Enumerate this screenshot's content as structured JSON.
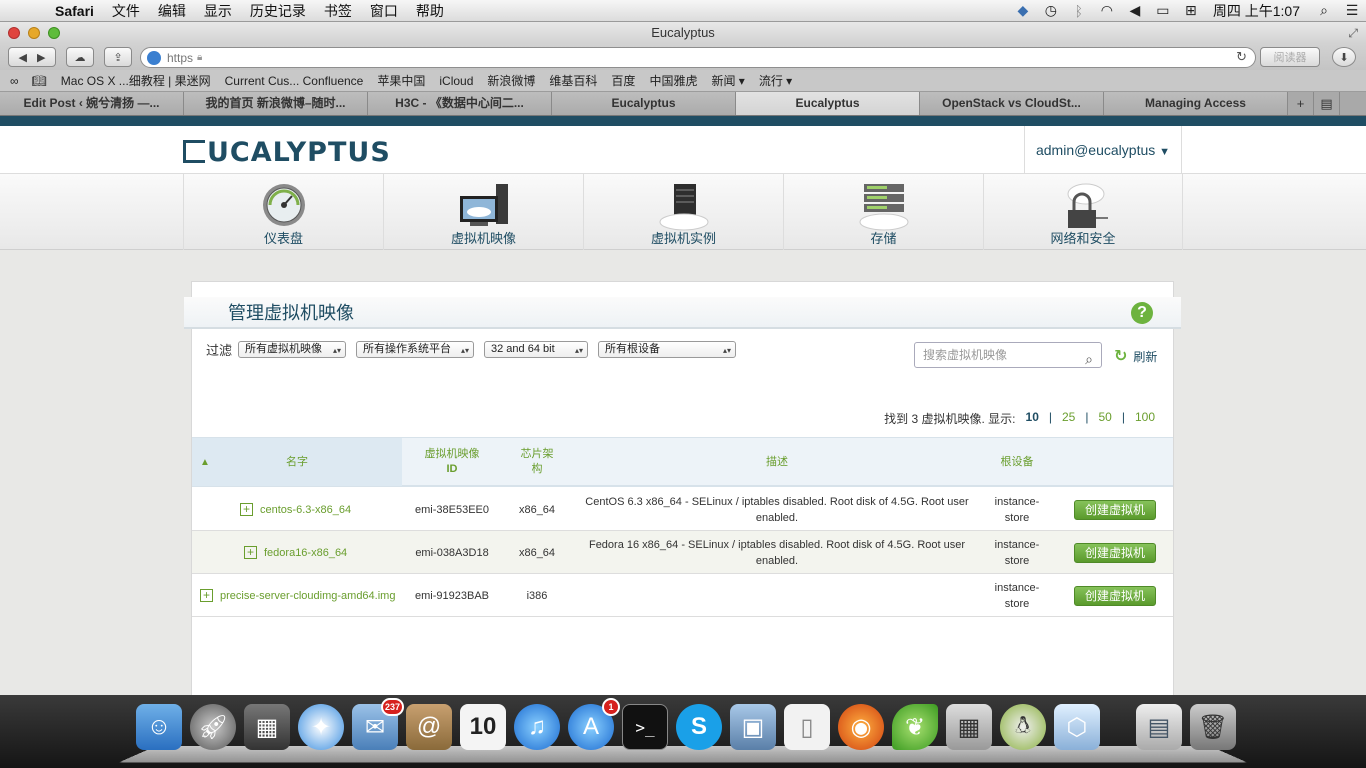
{
  "menubar": {
    "app": "Safari",
    "items": [
      "文件",
      "编辑",
      "显示",
      "历史记录",
      "书签",
      "窗口",
      "帮助"
    ],
    "clock": "周四 上午1:07"
  },
  "window": {
    "title": "Eucalyptus"
  },
  "toolbar": {
    "url_text": "https",
    "reader_label": "阅读器"
  },
  "bookmarks": [
    "Mac OS X ...细教程 | 果迷网",
    "Current Cus... Confluence",
    "苹果中国",
    "iCloud",
    "新浪微博",
    "维基百科",
    "百度",
    "中国雅虎",
    "新闻 ▾",
    "流行 ▾"
  ],
  "tabs": [
    {
      "label": "Edit Post ‹ 婉兮清扬 —...",
      "active": false
    },
    {
      "label": "我的首页 新浪微博–随时...",
      "active": false
    },
    {
      "label": "H3C - 《数据中心间二...",
      "active": false
    },
    {
      "label": "Eucalyptus",
      "active": false
    },
    {
      "label": "Eucalyptus",
      "active": true
    },
    {
      "label": "OpenStack vs CloudSt...",
      "active": false
    },
    {
      "label": "Managing Access",
      "active": false
    }
  ],
  "header": {
    "logo": "UCALYPTUS",
    "user": "admin@eucalyptus"
  },
  "nav": [
    {
      "label": "仪表盘",
      "icon": "dashboard-gauge-icon"
    },
    {
      "label": "虚拟机映像",
      "icon": "vm-image-icon"
    },
    {
      "label": "虚拟机实例",
      "icon": "vm-instance-icon"
    },
    {
      "label": "存储",
      "icon": "storage-icon"
    },
    {
      "label": "网络和安全",
      "icon": "network-security-icon"
    }
  ],
  "panel": {
    "title": "管理虚拟机映像",
    "help": "?",
    "filter_label": "过滤",
    "filters": [
      "所有虚拟机映像",
      "所有操作系统平台",
      "32 and 64 bit",
      "所有根设备"
    ],
    "search_placeholder": "搜索虚拟机映像",
    "refresh": "刷新",
    "count_text": "找到 3 虚拟机映像. 显示:",
    "page_sizes": [
      "10",
      "25",
      "50",
      "100"
    ],
    "current_page_size": "10",
    "columns": {
      "name": "名字",
      "id_line1": "虚拟机映像",
      "id_line2": "ID",
      "arch_line1": "芯片架",
      "arch_line2": "构",
      "desc": "描述",
      "root": "根设备"
    },
    "rows": [
      {
        "name": "centos-6.3-x86_64",
        "id": "emi-38E53EE0",
        "arch": "x86_64",
        "desc": "CentOS 6.3 x86_64 - SELinux / iptables disabled. Root disk of 4.5G. Root user enabled.",
        "root_line1": "instance-",
        "root_line2": "store",
        "action": "创建虚拟机"
      },
      {
        "name": "fedora16-x86_64",
        "id": "emi-038A3D18",
        "arch": "x86_64",
        "desc": "Fedora 16 x86_64 - SELinux / iptables disabled. Root disk of 4.5G. Root user enabled.",
        "root_line1": "instance-",
        "root_line2": "store",
        "action": "创建虚拟机"
      },
      {
        "name": "precise-server-cloudimg-amd64.img",
        "id": "emi-91923BAB",
        "arch": "i386",
        "desc": "",
        "root_line1": "instance-",
        "root_line2": "store",
        "action": "创建虚拟机"
      }
    ]
  },
  "dock": {
    "mail_badge": "237",
    "appstore_badge": "1",
    "calendar_day": "10"
  },
  "colors": {
    "brand": "#1f4d63",
    "accent_green": "#6db33f"
  }
}
